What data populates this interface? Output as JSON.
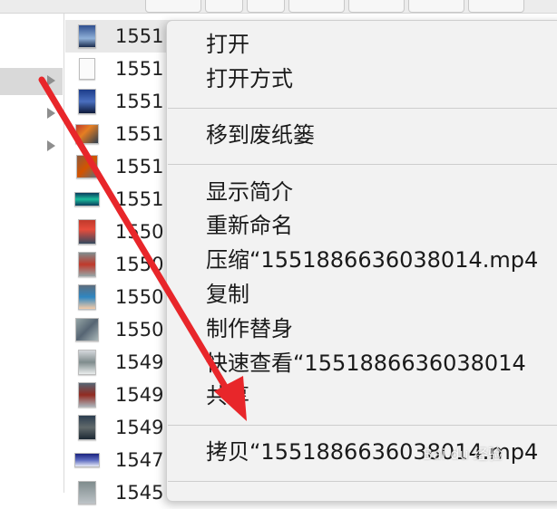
{
  "files": [
    {
      "name": "1551"
    },
    {
      "name": "1551"
    },
    {
      "name": "1551"
    },
    {
      "name": "1551"
    },
    {
      "name": "1551"
    },
    {
      "name": "1551"
    },
    {
      "name": "1550"
    },
    {
      "name": "1550"
    },
    {
      "name": "1550"
    },
    {
      "name": "1550"
    },
    {
      "name": "1549"
    },
    {
      "name": "1549"
    },
    {
      "name": "1549"
    },
    {
      "name": "1547"
    },
    {
      "name": "1545"
    }
  ],
  "context_menu": {
    "open": "打开",
    "open_with": "打开方式",
    "move_to_trash": "移到废纸篓",
    "get_info": "显示简介",
    "rename": "重新命名",
    "compress": "压缩“1551886636038014.mp4",
    "duplicate": "复制",
    "make_alias": "制作替身",
    "quick_look": "快速查看“1551886636038014",
    "share": "共享",
    "copy": "拷贝“1551886636038014.mp4"
  },
  "annotation": {
    "arrow_color": "#e8262a"
  },
  "watermark": "Bai du 经验"
}
